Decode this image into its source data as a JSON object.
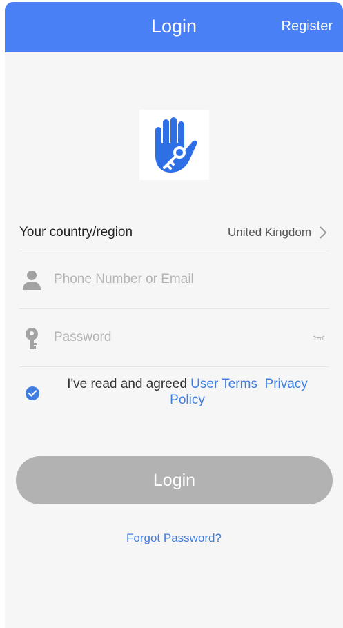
{
  "header": {
    "title": "Login",
    "register_label": "Register"
  },
  "logo": {
    "icon": "hand-key-icon"
  },
  "country": {
    "label": "Your country/region",
    "value": "United Kingdom",
    "icon": "chevron-right-icon"
  },
  "phone": {
    "placeholder": "Phone Number or Email",
    "value": "",
    "icon": "person-icon"
  },
  "password": {
    "placeholder": "Password",
    "value": "",
    "icon": "key-icon",
    "toggle_icon": "eye-closed-icon"
  },
  "agreement": {
    "checked": true,
    "text": "I've read and agreed ",
    "user_terms": "User Terms",
    "separator": "  ",
    "privacy_policy": "Privacy Policy"
  },
  "login_button": {
    "label": "Login"
  },
  "forgot_password": {
    "label": "Forgot Password?"
  },
  "colors": {
    "primary": "#4a80f6",
    "link": "#3f7de0",
    "button_disabled": "#b2b2b2",
    "background": "#f6f6f6",
    "placeholder": "#b4b4b4"
  }
}
